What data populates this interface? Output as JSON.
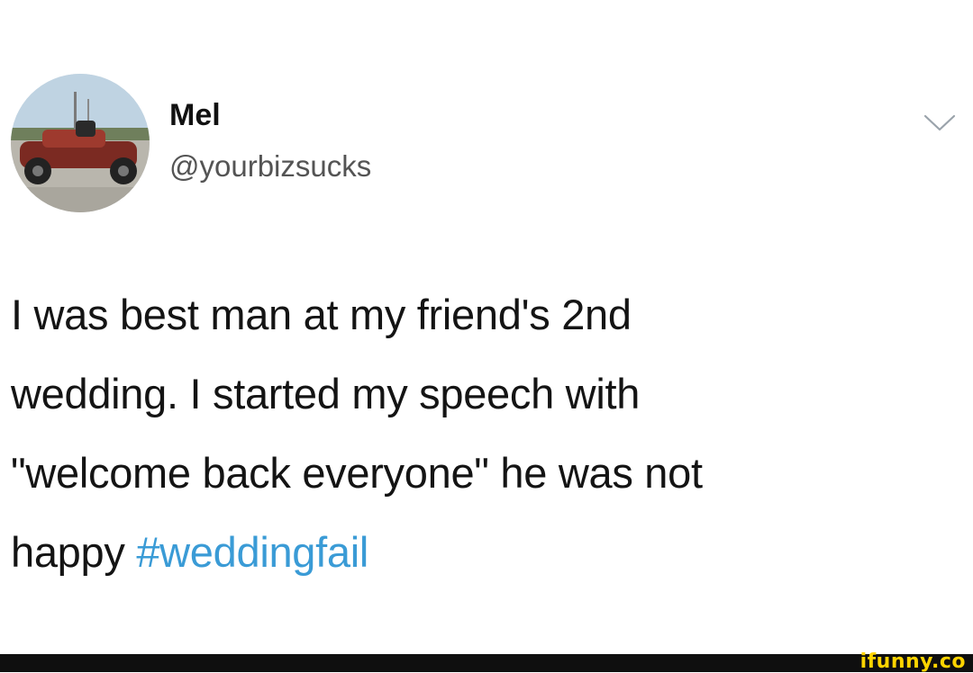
{
  "author": {
    "display_name": "Mel",
    "handle": "@yourbizsucks",
    "avatar_icon": "avatar-photo-car"
  },
  "menu": {
    "icon": "chevron-down-icon"
  },
  "tweet": {
    "lines": [
      "I was best man at my friend's 2nd",
      "wedding. I started my speech with",
      "\"welcome back everyone\" he was not"
    ],
    "last_line_prefix": "happy ",
    "hashtag": "#weddingfail"
  },
  "watermark": {
    "text": "ifunny.co"
  },
  "colors": {
    "hashtag": "#3a9bd6",
    "text": "#141414",
    "handle": "#545454",
    "footer": "#0f0f0f",
    "watermark": "#ffd400"
  }
}
